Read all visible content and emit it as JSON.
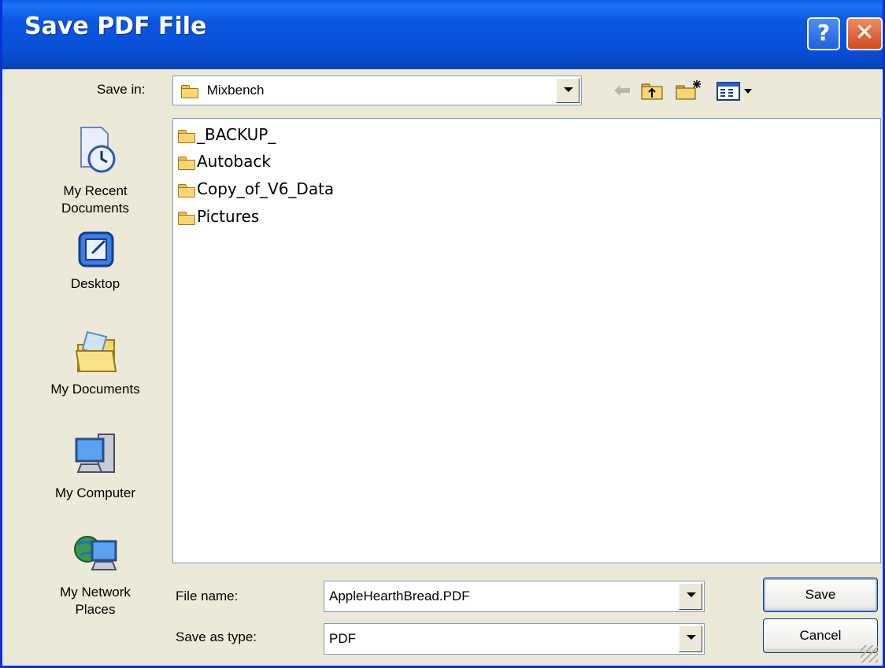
{
  "window": {
    "title": "Save PDF File"
  },
  "titlebar": {
    "help_symbol": "?",
    "close_symbol": "✕"
  },
  "save_in": {
    "label": "Save in:",
    "value": "Mixbench"
  },
  "toolbar": {
    "icons": [
      "back-arrow-icon",
      "up-one-level-icon",
      "create-new-folder-icon",
      "view-menu-icon"
    ]
  },
  "places": [
    {
      "label_line1": "My Recent",
      "label_line2": "Documents",
      "icon": "recent-documents-icon"
    },
    {
      "label_line1": "Desktop",
      "label_line2": "",
      "icon": "desktop-icon"
    },
    {
      "label_line1": "My Documents",
      "label_line2": "",
      "icon": "my-documents-icon"
    },
    {
      "label_line1": "My Computer",
      "label_line2": "",
      "icon": "my-computer-icon"
    },
    {
      "label_line1": "My Network",
      "label_line2": "Places",
      "icon": "network-places-icon"
    }
  ],
  "files": [
    {
      "name": "_BACKUP_",
      "type": "folder"
    },
    {
      "name": "Autoback",
      "type": "folder"
    },
    {
      "name": "Copy_of_V6_Data",
      "type": "folder"
    },
    {
      "name": "Pictures",
      "type": "folder"
    }
  ],
  "file_name": {
    "label": "File name:",
    "value": "AppleHearthBread.PDF"
  },
  "save_as_type": {
    "label": "Save as type:",
    "value": "PDF"
  },
  "buttons": {
    "save": "Save",
    "cancel": "Cancel"
  },
  "colors": {
    "title_bar": "#0a58e0",
    "dialog_bg": "#ece9d8",
    "close_button": "#d24a1e",
    "folder": "#f9d66f"
  }
}
